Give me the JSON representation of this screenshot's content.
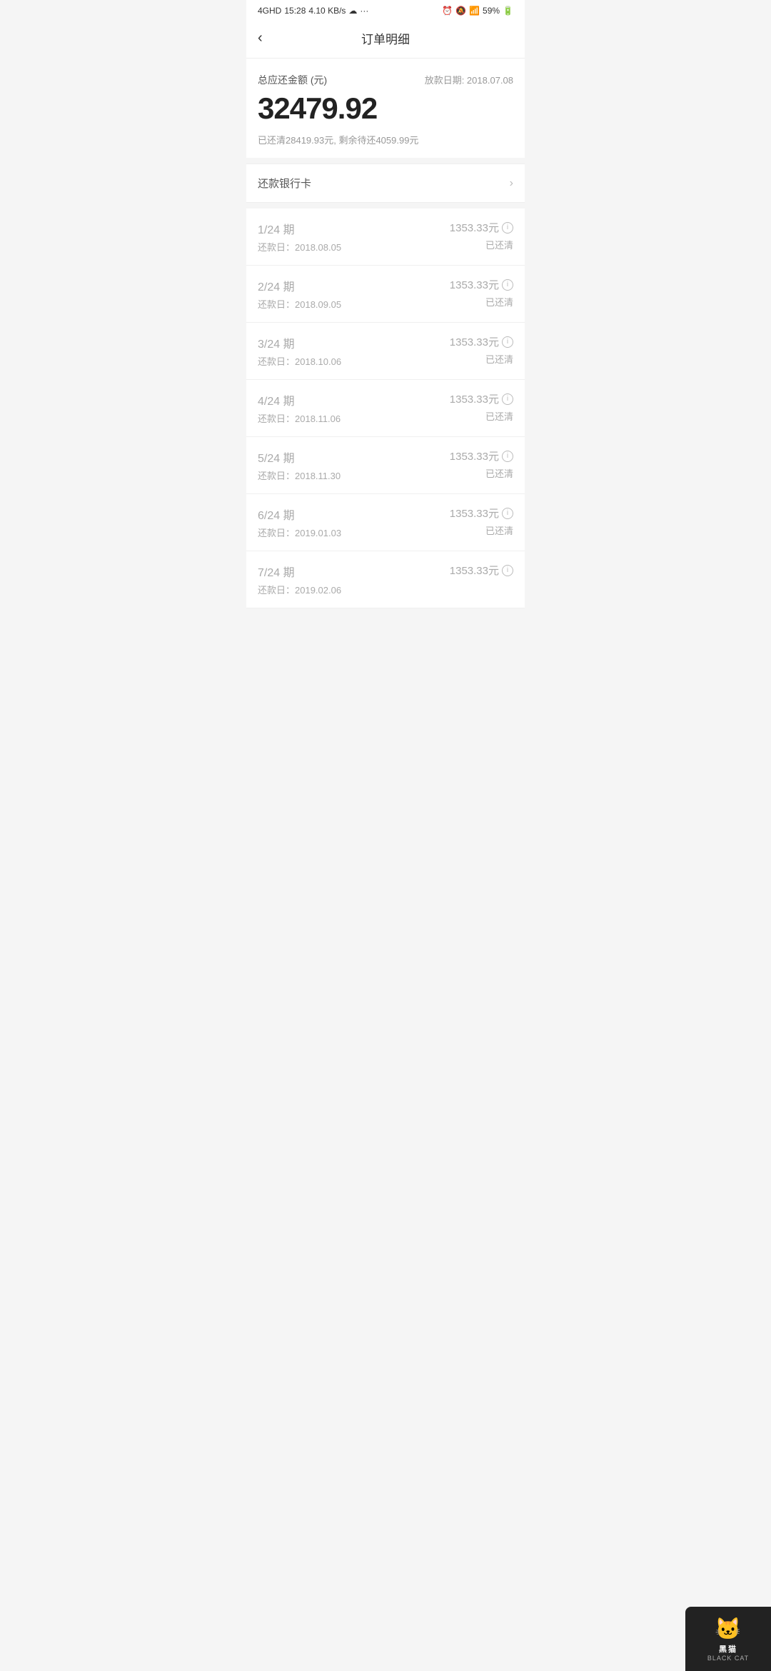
{
  "statusBar": {
    "time": "15:28",
    "signal": "4GHD",
    "data": "4.10 KB/s",
    "battery": "59%"
  },
  "header": {
    "backLabel": "‹",
    "title": "订单明细"
  },
  "summary": {
    "label": "总应还金额 (元)",
    "dateLabel": "放款日期: 2018.07.08",
    "amount": "32479.92",
    "detail": "已还清28419.93元, 剩余待还4059.99元"
  },
  "bankCard": {
    "label": "还款银行卡"
  },
  "installments": [
    {
      "period": "1/24 期",
      "date": "还款日：2018.08.05",
      "amount": "1353.33元",
      "status": "已还清"
    },
    {
      "period": "2/24 期",
      "date": "还款日：2018.09.05",
      "amount": "1353.33元",
      "status": "已还清"
    },
    {
      "period": "3/24 期",
      "date": "还款日：2018.10.06",
      "amount": "1353.33元",
      "status": "已还清"
    },
    {
      "period": "4/24 期",
      "date": "还款日：2018.11.06",
      "amount": "1353.33元",
      "status": "已还清"
    },
    {
      "period": "5/24 期",
      "date": "还款日：2018.11.30",
      "amount": "1353.33元",
      "status": "已还清"
    },
    {
      "period": "6/24 期",
      "date": "还款日：2019.01.03",
      "amount": "1353.33元",
      "status": "已还清"
    },
    {
      "period": "7/24 期",
      "date": "还款日：2019.02.06",
      "amount": "1353.33元",
      "status": ""
    }
  ],
  "watermark": {
    "cat": "🐱",
    "text": "黑猫",
    "sub": "BLACK CAT"
  }
}
